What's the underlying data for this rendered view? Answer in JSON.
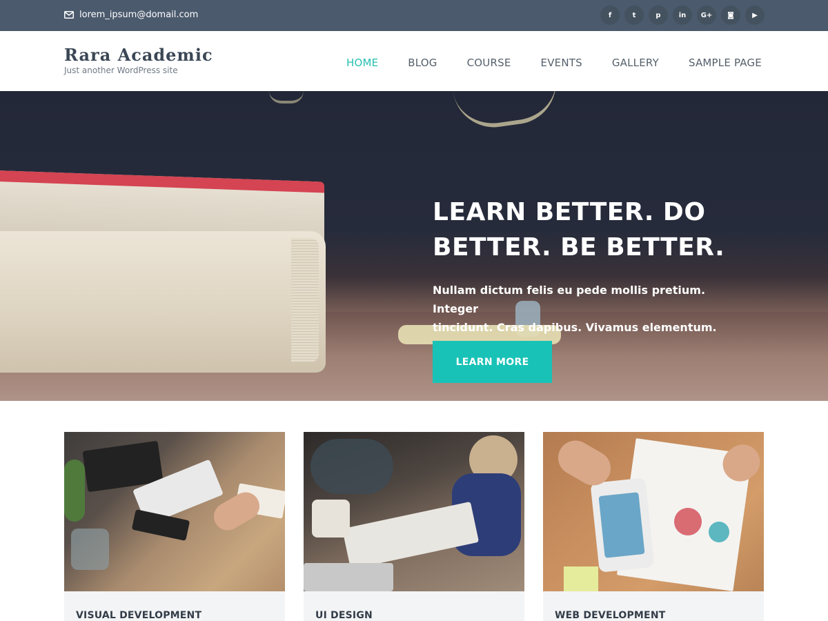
{
  "topbar": {
    "email": "lorem_ipsum@domail.com",
    "social_icons": [
      {
        "name": "facebook-icon",
        "glyph": "f"
      },
      {
        "name": "twitter-icon",
        "glyph": "t"
      },
      {
        "name": "pinterest-icon",
        "glyph": "p"
      },
      {
        "name": "linkedin-icon",
        "glyph": "in"
      },
      {
        "name": "google-plus-icon",
        "glyph": "G+"
      },
      {
        "name": "instagram-icon",
        "glyph": "◙"
      },
      {
        "name": "youtube-icon",
        "glyph": "▶"
      }
    ]
  },
  "header": {
    "site_title": "Rara Academic",
    "tagline": "Just another WordPress site",
    "nav": [
      "HOME",
      "BLOG",
      "COURSE",
      "EVENTS",
      "GALLERY",
      "SAMPLE PAGE"
    ],
    "active_nav": "HOME"
  },
  "hero": {
    "title_line1": "LEARN BETTER. DO",
    "title_line2": "BETTER. BE BETTER.",
    "subtitle_line1": "Nullam dictum felis eu pede mollis pretium. Integer",
    "subtitle_line2": "tincidunt. Cras dapibus. Vivamus elementum.",
    "button": "LEARN MORE"
  },
  "cards": [
    {
      "label": "VISUAL DEVELOPMENT"
    },
    {
      "label": "UI DESIGN"
    },
    {
      "label": "WEB DEVELOPMENT"
    }
  ],
  "colors": {
    "topbar": "#4b5a6d",
    "accent": "#19c2b6",
    "nav_active": "#26bfb2"
  }
}
